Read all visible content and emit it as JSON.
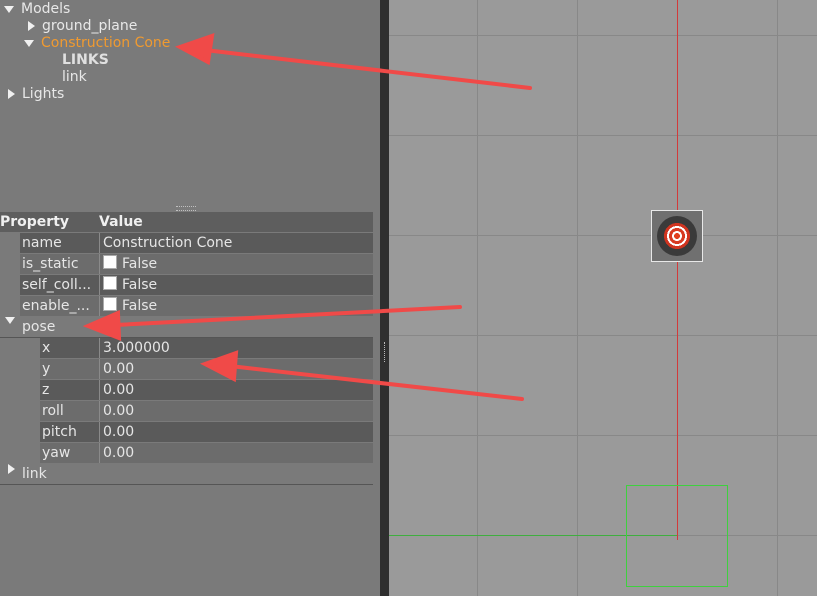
{
  "tree": {
    "models_label": "Models",
    "ground_plane_label": "ground_plane",
    "construction_cone_label": "Construction Cone",
    "links_header": "LINKS",
    "link_label": "link",
    "lights_label": "Lights"
  },
  "properties": {
    "header_property": "Property",
    "header_value": "Value",
    "name_key": "name",
    "name_value": "Construction Cone",
    "is_static_key": "is_static",
    "is_static_value": "False",
    "self_collide_key": "self_coll...",
    "self_collide_value": "False",
    "enable_wind_key": "enable_...",
    "enable_wind_value": "False",
    "pose_label": "pose",
    "x_key": "x",
    "x_value": "3.000000",
    "y_key": "y",
    "y_value": "0.00",
    "z_key": "z",
    "z_value": "0.00",
    "roll_key": "roll",
    "roll_value": "0.00",
    "pitch_key": "pitch",
    "pitch_value": "0.00",
    "yaw_key": "yaw",
    "yaw_value": "0.00",
    "link_label": "link"
  },
  "colors": {
    "selected_text": "#f09a30",
    "annotation_arrow": "#f04a48",
    "x_axis": "#d23a3a",
    "y_axis": "#3fae3f"
  }
}
